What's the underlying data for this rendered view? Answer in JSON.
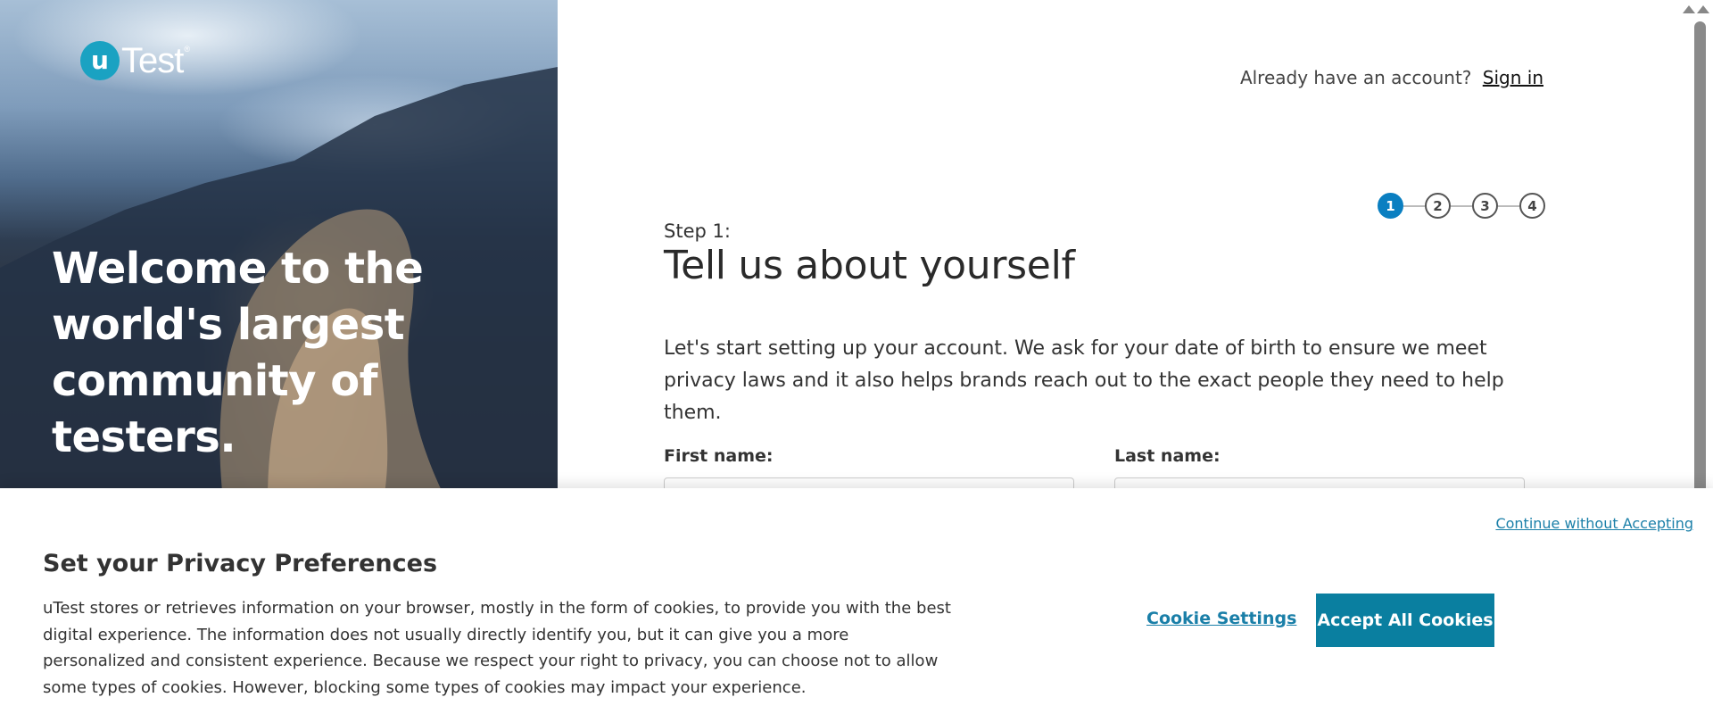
{
  "hero": {
    "logo_mark": "u",
    "logo_text": "Test",
    "logo_tm": "®",
    "heading": "Welcome to the world's largest community of testers."
  },
  "header": {
    "account_prompt": "Already have an account?",
    "sign_in_label": "Sign in"
  },
  "stepper": {
    "steps": [
      "1",
      "2",
      "3",
      "4"
    ],
    "active": 1
  },
  "form": {
    "step_label": "Step 1:",
    "title": "Tell us about yourself",
    "intro": "Let's start setting up your account. We ask for your date of birth to ensure we meet privacy laws and it also helps brands reach out to the exact people they need to help them.",
    "first_name_label": "First name:",
    "last_name_label": "Last name:"
  },
  "cookie_banner": {
    "continue_label": "Continue without Accepting",
    "title": "Set your Privacy Preferences",
    "text": "uTest stores or retrieves information on your browser, mostly in the form of cookies, to provide you with the best digital experience. The information does not usually directly identify you, but it can give you a more personalized and consistent experience. Because we respect your right to privacy, you can choose not to allow some types of cookies. However, blocking some types of cookies may impact your experience.",
    "settings_label": "Cookie Settings",
    "accept_label": "Accept All Cookies"
  },
  "colors": {
    "brand_blue": "#0a7fc1",
    "cookie_accent": "#0a7fa0",
    "logo_teal": "#1aa2c2"
  }
}
